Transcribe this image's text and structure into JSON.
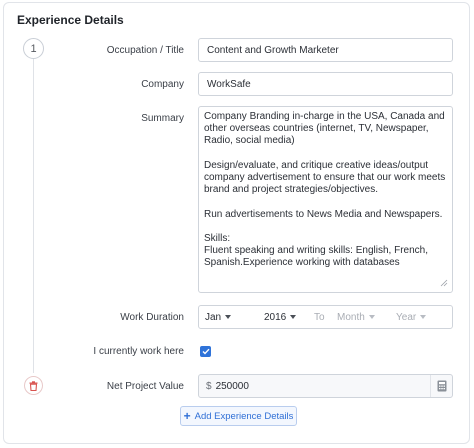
{
  "section_title": "Experience Details",
  "step_number": "1",
  "fields": {
    "occupation": {
      "label": "Occupation / Title",
      "value": "Content and Growth Marketer"
    },
    "company": {
      "label": "Company",
      "value": "WorkSafe"
    },
    "summary": {
      "label": "Summary",
      "value": "Company Branding in-charge in the USA, Canada and other overseas countries (internet, TV, Newspaper, Radio, social media)\n\nDesign/evaluate, and critique creative ideas/output company advertisement to ensure that our work meets brand and project strategies/objectives.\n\nRun advertisements to News Media and Newspapers.\n\nSkills:\nFluent speaking and writing skills: English, French, Spanish.Experience working with databases"
    },
    "work_duration": {
      "label": "Work Duration",
      "start_month": "Jan",
      "start_year": "2016",
      "to_label": "To",
      "end_month_placeholder": "Month",
      "end_year_placeholder": "Year"
    },
    "currently_work": {
      "label": "I currently work here",
      "checked": true
    },
    "net_project_value": {
      "label": "Net Project Value",
      "currency": "$",
      "value": "250000"
    }
  },
  "add_button_label": "Add Experience Details",
  "colors": {
    "accent": "#2f73d9",
    "delete": "#d9534f",
    "border": "#cfd4db"
  },
  "icons": {
    "delete": "trash-icon",
    "calculator": "calculator-icon",
    "check": "check-icon",
    "add": "plus-icon"
  }
}
